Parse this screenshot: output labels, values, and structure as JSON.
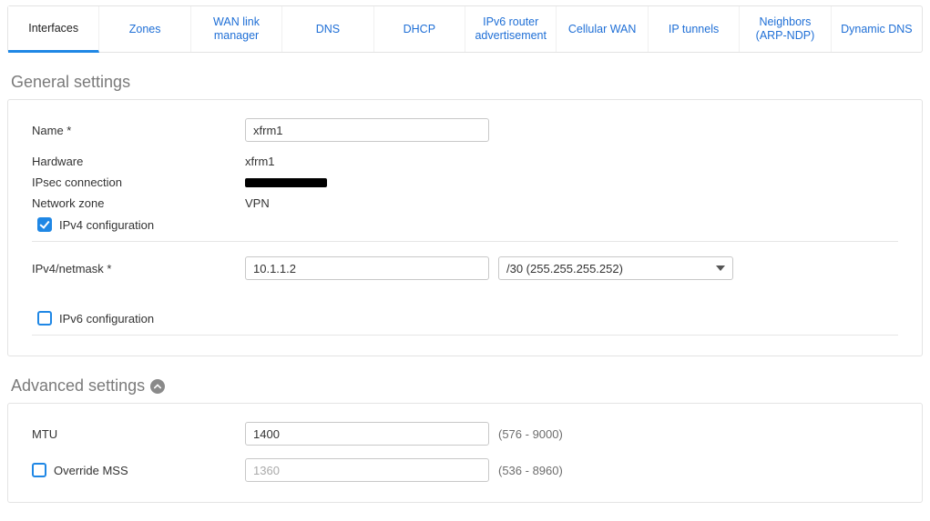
{
  "tabs": {
    "interfaces": "Interfaces",
    "zones": "Zones",
    "wan_link": "WAN link manager",
    "dns": "DNS",
    "dhcp": "DHCP",
    "ipv6_ra": "IPv6 router advertisement",
    "cellular": "Cellular WAN",
    "ip_tunnels": "IP tunnels",
    "neighbors": "Neighbors (ARP-NDP)",
    "ddns": "Dynamic DNS"
  },
  "general": {
    "title": "General settings",
    "name_label": "Name *",
    "name_value": "xfrm1",
    "hardware_label": "Hardware",
    "hardware_value": "xfrm1",
    "ipsec_label": "IPsec connection",
    "zone_label": "Network zone",
    "zone_value": "VPN",
    "ipv4_cfg_label": "IPv4 configuration",
    "ipv4_netmask_label": "IPv4/netmask *",
    "ipv4_value": "10.1.1.2",
    "netmask_selected": "/30 (255.255.255.252)",
    "ipv6_cfg_label": "IPv6 configuration"
  },
  "advanced": {
    "title": "Advanced settings",
    "mtu_label": "MTU",
    "mtu_value": "1400",
    "mtu_hint": "(576 - 9000)",
    "mss_label": "Override MSS",
    "mss_value": "1360",
    "mss_hint": "(536 - 8960)"
  }
}
